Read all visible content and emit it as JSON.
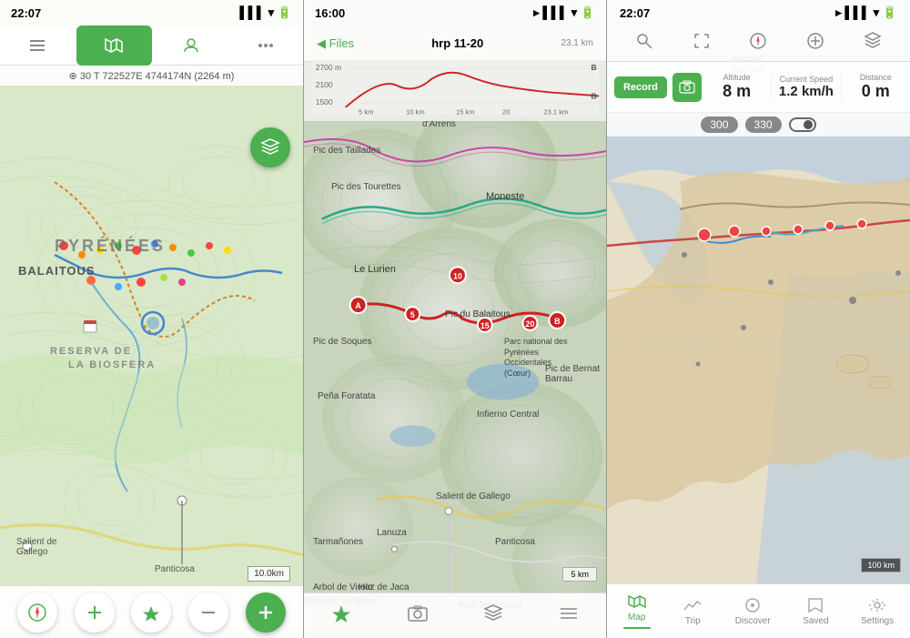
{
  "panel1": {
    "status_bar": {
      "time": "22:07",
      "icons": [
        "signal",
        "wifi",
        "battery"
      ]
    },
    "toolbar": {
      "btn1_label": "menu",
      "btn2_label": "map",
      "btn3_label": "profile",
      "btn4_label": "more"
    },
    "coord_text": "⊕ 30 T 722527E 4744174N  (2264 m)",
    "map_labels": {
      "pyrenes": "PYRÉNÉES",
      "balaitous": "BALAITOUS",
      "reserva": "RESERVA DE LA BIOSFERA",
      "salient": "Salient de Gallego",
      "panticosa": "Panticosa"
    },
    "scale": "10.0km",
    "layers_icon": "layers",
    "bottom_btns": [
      "compass",
      "plus",
      "location",
      "minus",
      "add-green"
    ]
  },
  "panel2": {
    "status_bar": {
      "time": "16:00",
      "location_icon": "location-arrow"
    },
    "nav_bar": {
      "back_label": "◀ Files",
      "title": "hrp 11-20",
      "distances": "10 km   15 km   20   23.1 km"
    },
    "elevation_labels": [
      "2700 m",
      "2100",
      "1500"
    ],
    "map_labels": {
      "moneste": "Moneste",
      "lurien": "Le Lurien",
      "balaitous": "Pic du Balaitous",
      "bernat": "Pic de Bernat\nBarrau",
      "soques": "Pic de Soques",
      "peña": "Peña Foratata",
      "infierno": "Infierno Central",
      "panticosa": "Panticosa",
      "parc": "Parc national des\nPyrénées\nOccidentales\n(Cœur)",
      "salient": "Salient de Gallego",
      "lanuza": "Lanuza",
      "tarmañones": "Tarmañones",
      "virolo": "Arbol de Virolo",
      "tendenera": "Pico Tendenera",
      "embalse": "Embalse de Búbal"
    },
    "route_points": [
      "A",
      "5",
      "10",
      "15",
      "20",
      "B"
    ],
    "bottom_btns": [
      "location",
      "camera",
      "layers",
      "list"
    ]
  },
  "panel3": {
    "status_bar": {
      "time": "22:07",
      "location_icon": "location-arrow"
    },
    "toolbar_icons": [
      "search",
      "expand",
      "compass",
      "plus",
      "layers"
    ],
    "stats": {
      "record_btn": "Record",
      "camera_icon": "camera",
      "altitude_label": "Altitude",
      "altitude_value": "8 m",
      "speed_label": "Current Speed",
      "speed_value": "1.2 km/h",
      "distance_label": "Distance",
      "distance_value": "0 m"
    },
    "counter": {
      "val1": "300",
      "val2": "330"
    },
    "scale": "100 km",
    "map_label": "Accord",
    "bottom_nav": [
      {
        "label": "Map",
        "icon": "map",
        "active": true
      },
      {
        "label": "Trip",
        "icon": "trip",
        "active": false
      },
      {
        "label": "Discover",
        "icon": "discover",
        "active": false
      },
      {
        "label": "Saved",
        "icon": "saved",
        "active": false
      },
      {
        "label": "Settings",
        "icon": "settings",
        "active": false
      }
    ]
  }
}
